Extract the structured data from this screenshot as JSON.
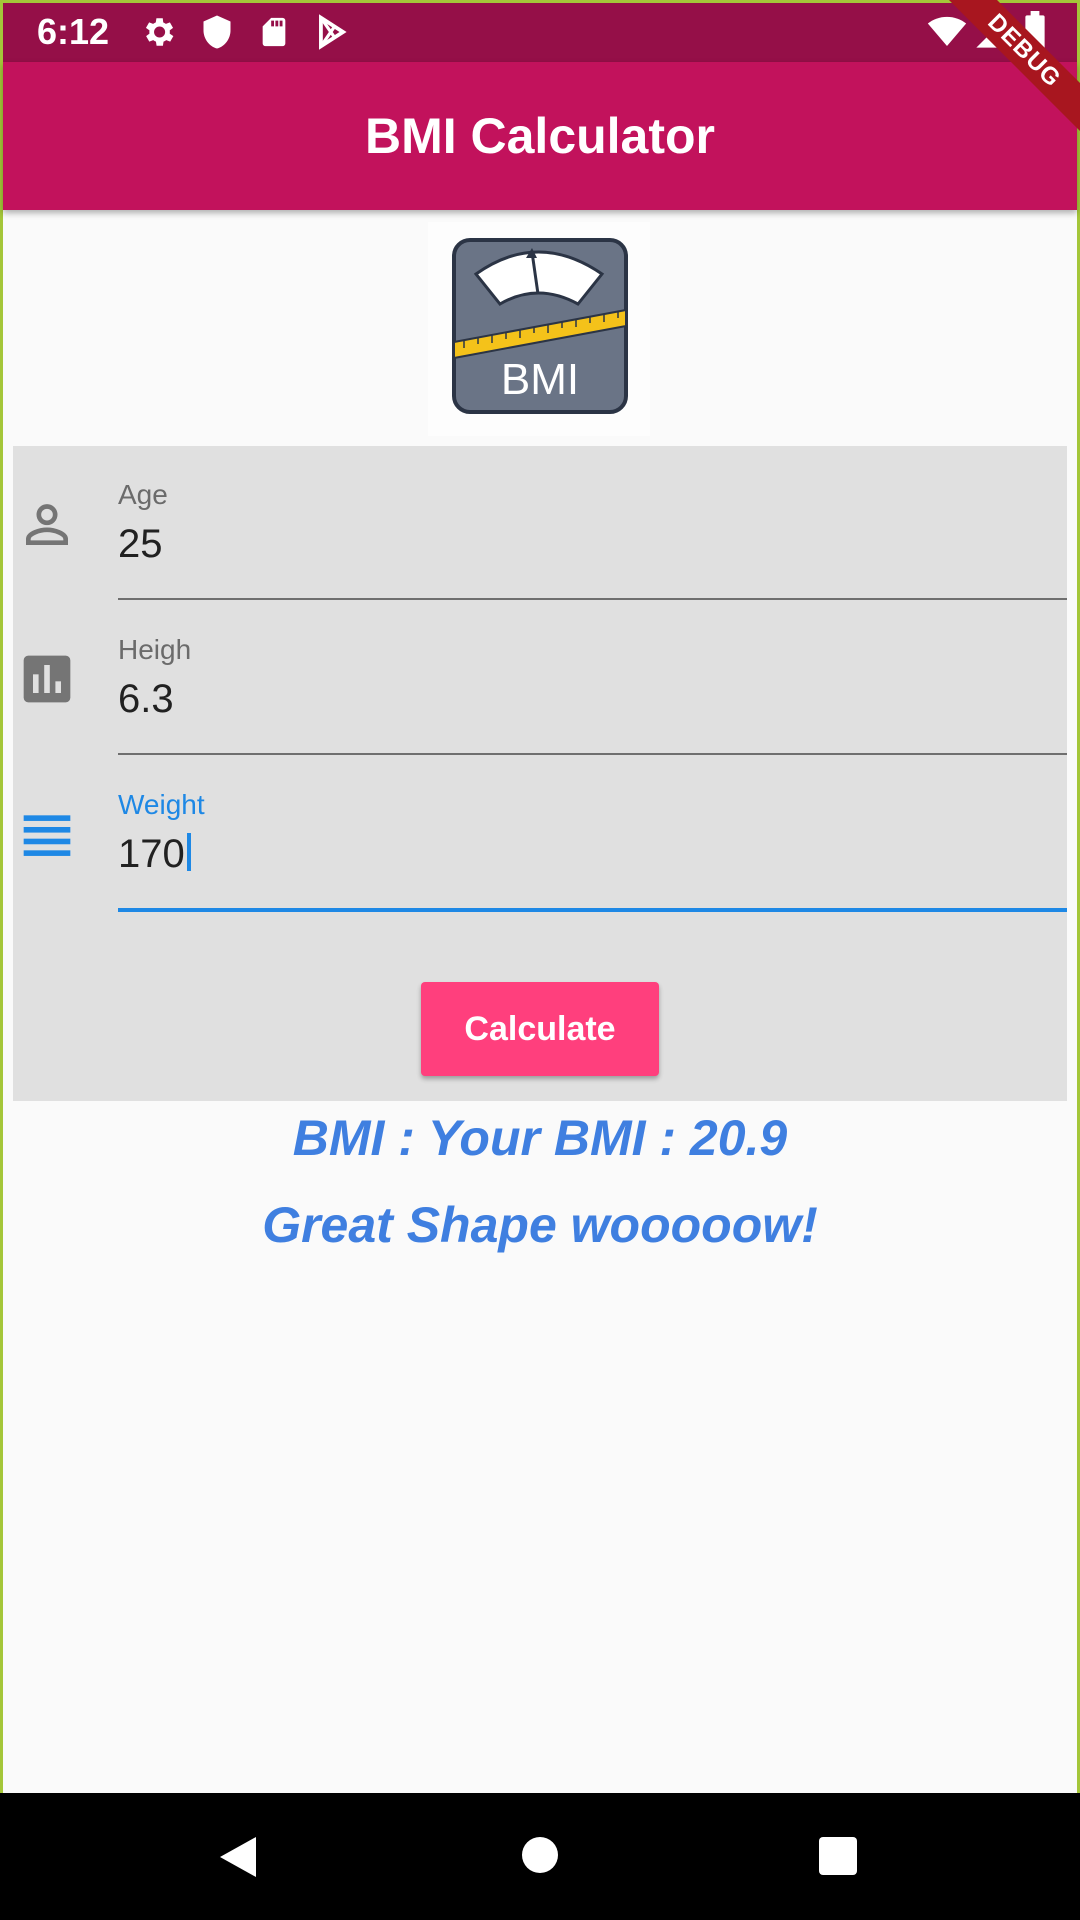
{
  "status_bar": {
    "time": "6:12",
    "icons": [
      "settings-icon",
      "shield-icon",
      "sd-card-icon",
      "play-store-icon",
      "wifi-icon",
      "signal-icon",
      "battery-icon"
    ],
    "debug_label": "DEBUG",
    "background": "#950f48"
  },
  "app_bar": {
    "title": "BMI Calculator",
    "background": "#c2125c"
  },
  "logo": {
    "text": "BMI"
  },
  "form": {
    "age": {
      "label": "Age",
      "value": "25",
      "icon": "person-icon"
    },
    "height": {
      "label": "Heigh",
      "value": "6.3",
      "icon": "bar-chart-icon"
    },
    "weight": {
      "label": "Weight",
      "value": "170",
      "icon": "lines-icon"
    },
    "button_label": "Calculate",
    "accent": "#1e88e5",
    "button_color": "#ff3f7d"
  },
  "result": {
    "bmi_text": "BMI : Your BMI : 20.9",
    "message": "Great Shape wooooow!",
    "color": "#3f7fe0"
  },
  "nav_bar": {
    "icons": [
      "back-icon",
      "home-icon",
      "recents-icon"
    ]
  }
}
